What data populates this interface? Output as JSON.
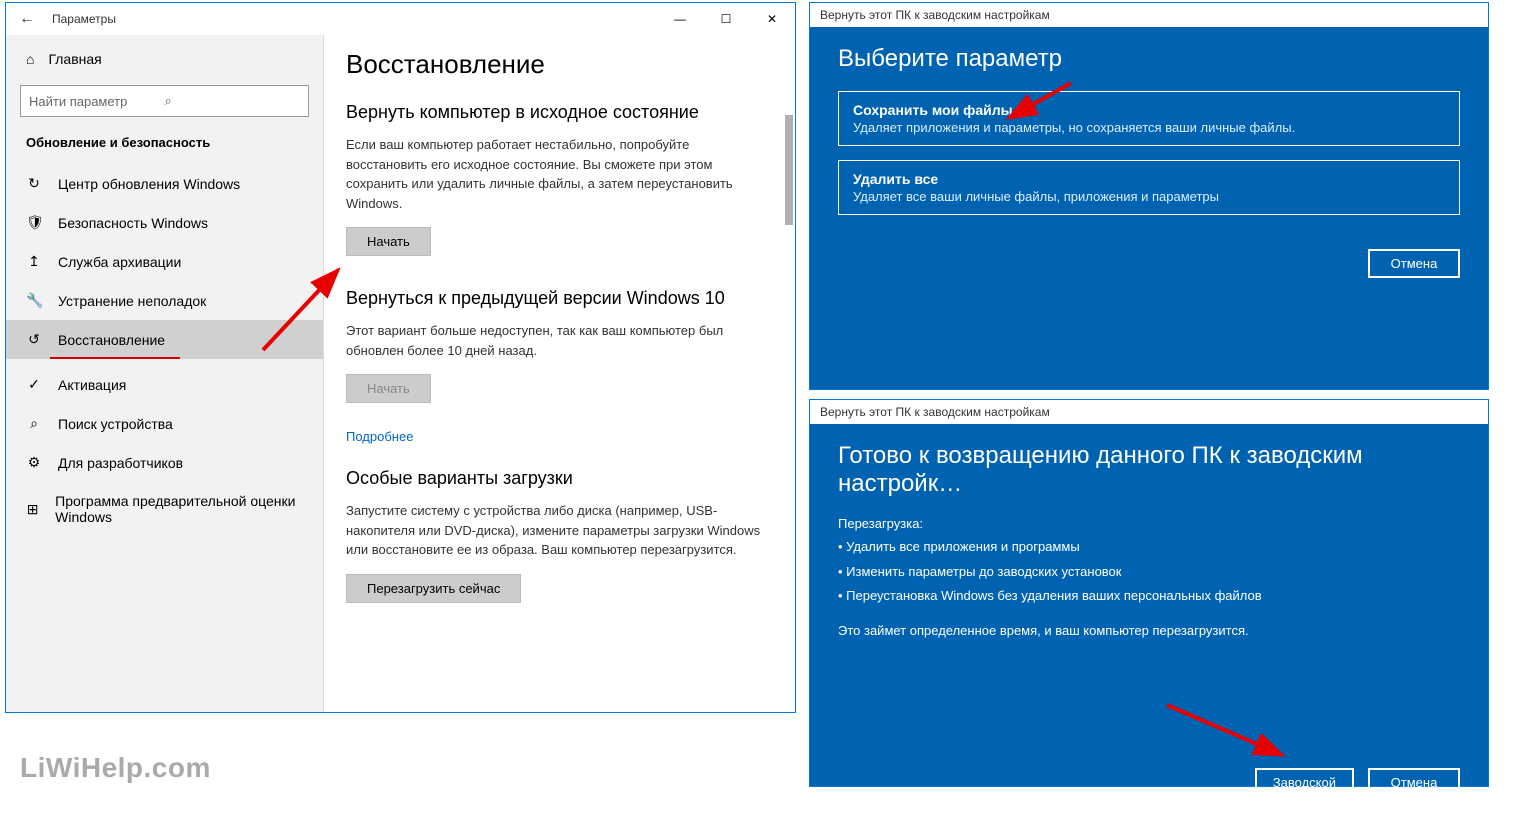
{
  "settings": {
    "title": "Параметры",
    "home": "Главная",
    "search_placeholder": "Найти параметр",
    "section": "Обновление и безопасность",
    "nav": [
      {
        "icon": "↻",
        "label": "Центр обновления Windows"
      },
      {
        "icon": "🛡",
        "label": "Безопасность Windows"
      },
      {
        "icon": "↥",
        "label": "Служба архивации"
      },
      {
        "icon": "🔧",
        "label": "Устранение неполадок"
      },
      {
        "icon": "↺",
        "label": "Восстановление"
      },
      {
        "icon": "✓",
        "label": "Активация"
      },
      {
        "icon": "⌕",
        "label": "Поиск устройства"
      },
      {
        "icon": "⚙",
        "label": "Для разработчиков"
      },
      {
        "icon": "⊞",
        "label": "Программа предварительной оценки Windows"
      }
    ]
  },
  "content": {
    "page_title": "Восстановление",
    "reset": {
      "heading": "Вернуть компьютер в исходное состояние",
      "body": "Если ваш компьютер работает нестабильно, попробуйте восстановить его исходное состояние. Вы сможете при этом сохранить или удалить личные файлы, а затем переустановить Windows.",
      "button": "Начать"
    },
    "rollback": {
      "heading": "Вернуться к предыдущей версии Windows 10",
      "body": "Этот вариант больше недоступен, так как ваш компьютер был обновлен более 10 дней назад.",
      "button": "Начать",
      "more": "Подробнее"
    },
    "advanced": {
      "heading": "Особые варианты загрузки",
      "body": "Запустите систему с устройства либо диска (например, USB-накопителя или DVD-диска), измените параметры загрузки Windows или восстановите ее из образа. Ваш компьютер перезагрузится.",
      "button": "Перезагрузить сейчас"
    }
  },
  "dlg1": {
    "titlebar": "Вернуть этот ПК к заводским настройкам",
    "heading": "Выберите параметр",
    "opt_keep_t": "Сохранить мои файлы",
    "opt_keep_d": "Удаляет приложения и параметры, но сохраняется ваши личные файлы.",
    "opt_del_t": "Удалить все",
    "opt_del_d": "Удаляет все ваши личные файлы, приложения и параметры",
    "cancel": "Отмена"
  },
  "dlg2": {
    "titlebar": "Вернуть этот ПК к заводским настройкам",
    "heading": "Готово к возвращению данного ПК к заводским настройк…",
    "sub": "Перезагрузка:",
    "b1": "Удалить все приложения и программы",
    "b2": "Изменить параметры до заводских установок",
    "b3": "Переустановка Windows без удаления ваших персональных файлов",
    "note": "Это займет определенное время, и ваш компьютер перезагрузится.",
    "ok": "Заводской",
    "cancel": "Отмена"
  },
  "watermark": "LiWiHelp.com"
}
